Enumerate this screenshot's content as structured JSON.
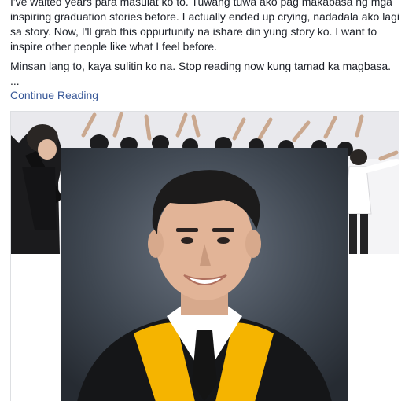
{
  "post": {
    "paragraph_1": "I've waited years para masulat ko to. Tuwang tuwa ako pag makabasa ng mga inspiring graduation stories before. I actually ended up crying, nadadala ako lagi sa story. Now, I'll grab this oppurtunity na ishare din yung story ko. I want to inspire other people like what I feel before.",
    "paragraph_2": "Minsan lang to, kaya sulitin ko na. Stop reading now kung tamad ka magbasa.",
    "ellipsis": "...",
    "continue_label": "Continue Reading"
  },
  "colors": {
    "link": "#385898",
    "text": "#1d2129",
    "toga_stripe": "#f5b400",
    "portrait_bg": "#2f3640"
  }
}
